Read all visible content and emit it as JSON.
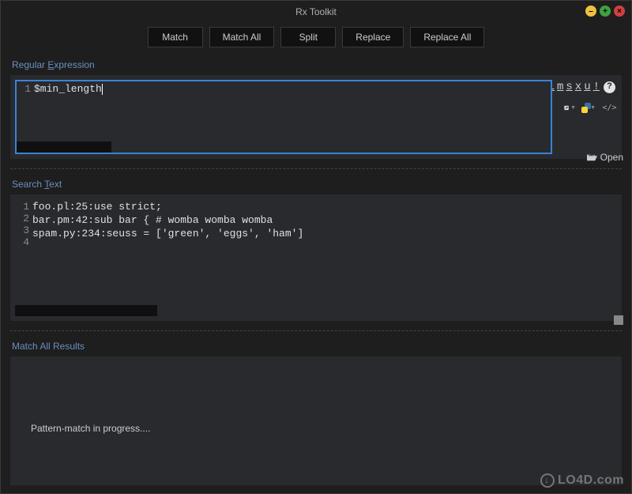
{
  "title": "Rx Toolkit",
  "toolbar": {
    "match": "Match",
    "match_all": "Match All",
    "split": "Split",
    "replace": "Replace",
    "replace_all": "Replace All"
  },
  "regex": {
    "label_prefix": "Regular ",
    "label_ul": "E",
    "label_suffix": "xpression",
    "line_no": "1",
    "content": "$min_length",
    "flags": {
      "slash": "/",
      "i": "i",
      "m": "m",
      "s": "s",
      "x": "x",
      "u": "u",
      "exclaim": "!"
    },
    "help": "?",
    "code_icon": "</>"
  },
  "search": {
    "label_prefix": "Search ",
    "label_ul": "T",
    "label_suffix": "ext",
    "open": "Open",
    "lines": [
      {
        "no": "1",
        "text": "foo.pl:25:use strict;"
      },
      {
        "no": "2",
        "text": "bar.pm:42:sub bar { # womba womba womba"
      },
      {
        "no": "3",
        "text": "spam.py:234:seuss = ['green', 'eggs', 'ham']"
      },
      {
        "no": "4",
        "text": ""
      }
    ]
  },
  "results": {
    "label": "Match All Results",
    "message": "Pattern-match in progress...."
  },
  "watermark": "LO4D.com"
}
